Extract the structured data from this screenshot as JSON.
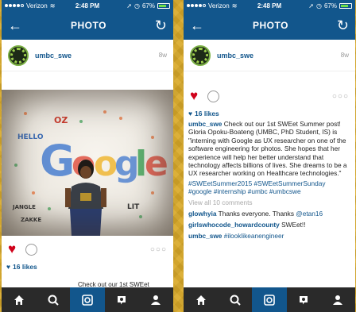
{
  "status": {
    "carrier": "Verizon",
    "time": "2:48 PM",
    "battery": "67%"
  },
  "nav": {
    "title": "PHOTO"
  },
  "post": {
    "username": "umbc_swe",
    "age": "8w",
    "likes": "16 likes",
    "caption_user": "umbc_swe",
    "caption_text": "Check out our 1st SWEet Summer post! Gloria Opoku-Boateng (UMBC, PhD Student, IS) is \"interning with Google as UX researcher on one of the software engineering for photos. She hopes that her experience will help her better understand that technology affects billions of lives. She dreams to be a UX researcher working on Healthcare technologies.\"",
    "hashtags": "#SWEetSummer2015 #SWEetSummerSunday #google #internship #umbc #umbcswe",
    "view_all": "View all 10 comments",
    "peek_text": "Check out our 1st SWEet"
  },
  "comments": [
    {
      "user": "glowhyia",
      "text": "Thanks everyone. Thanks ",
      "mention": "@etan16"
    },
    {
      "user": "girlswhocode_howardcounty",
      "text": "SWEet!!",
      "mention": ""
    },
    {
      "user": "umbc_swe",
      "text": "",
      "mention": "#ilooklikeanengineer"
    }
  ],
  "photo_doodles": [
    "OZ",
    "HELLO",
    "G",
    "o",
    "o",
    "g",
    "l",
    "e",
    "JANGLE",
    "ZAKKE",
    "LIT"
  ],
  "colors": {
    "brand_blue": "#12568c",
    "heart_red": "#d0021b",
    "tabbar": "#2a2a2a",
    "background": "#d9a928"
  },
  "tabs": [
    {
      "name": "home-icon"
    },
    {
      "name": "search-icon"
    },
    {
      "name": "camera-icon"
    },
    {
      "name": "activity-icon"
    },
    {
      "name": "profile-icon"
    }
  ]
}
